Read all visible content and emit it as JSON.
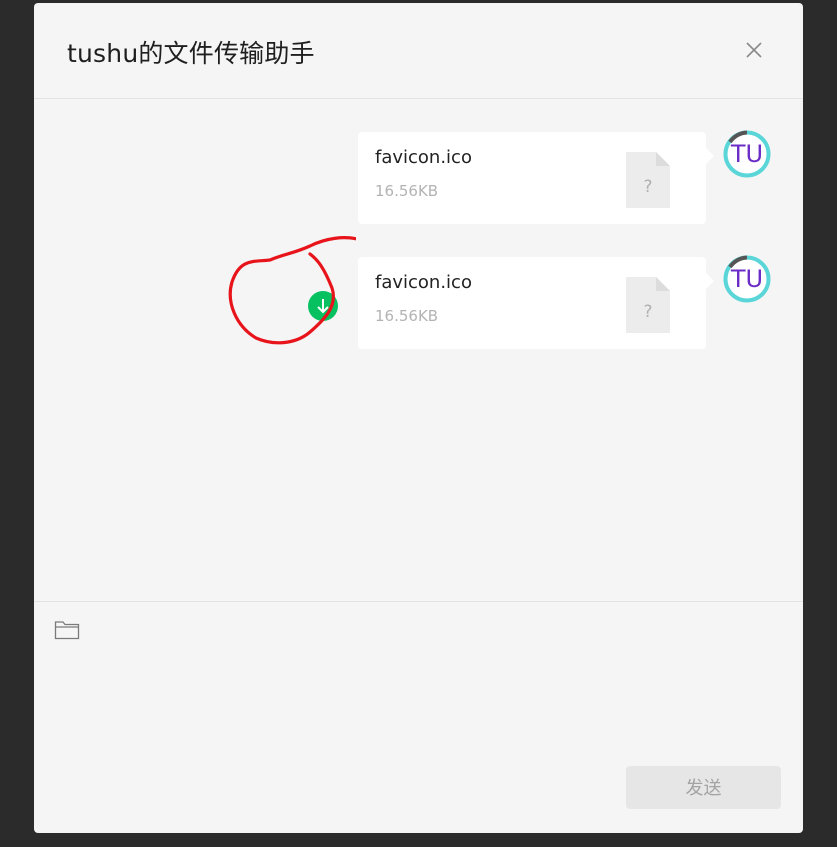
{
  "window": {
    "title": "tushu的文件传输助手",
    "close_icon": "close-icon"
  },
  "messages": [
    {
      "file_name": "favicon.ico",
      "file_size": "16.56KB",
      "file_icon": "unknown-file-icon",
      "avatar_text": "TU",
      "show_download": false
    },
    {
      "file_name": "favicon.ico",
      "file_size": "16.56KB",
      "file_icon": "unknown-file-icon",
      "avatar_text": "TU",
      "show_download": true,
      "download_icon": "download-arrow-icon"
    }
  ],
  "input": {
    "folder_icon": "folder-icon",
    "send_label": "发送"
  },
  "colors": {
    "download_green": "#07c160",
    "annotation_red": "#e8141b",
    "avatar_ring": "#5bd6d8",
    "avatar_text": "#6a2cc6",
    "send_bg": "#e6e6e6",
    "send_text": "#a3a3a3"
  },
  "annotation": {
    "type": "hand-drawn-circle",
    "target": "download-button"
  }
}
